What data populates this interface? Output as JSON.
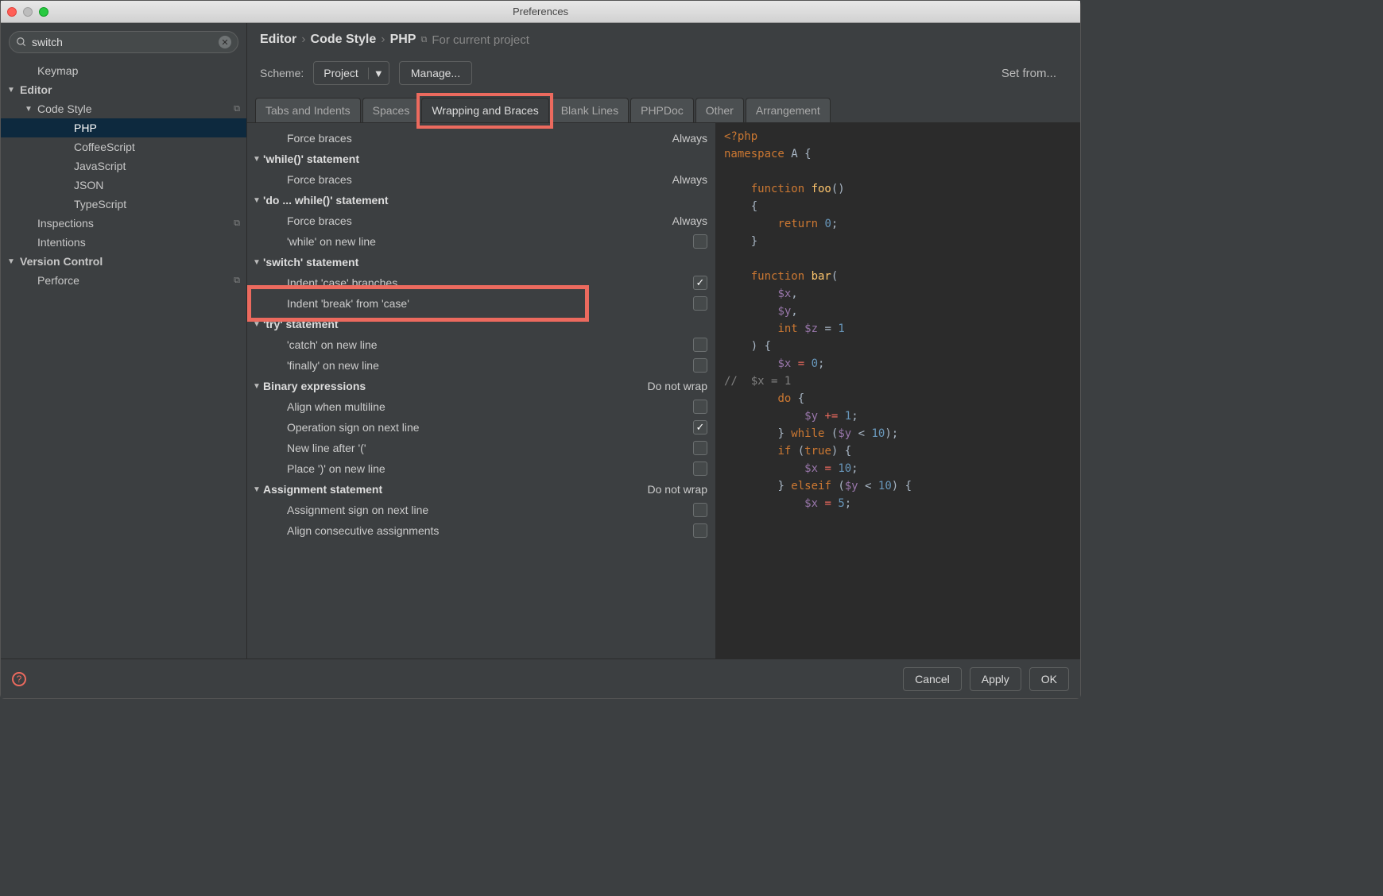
{
  "window": {
    "title": "Preferences"
  },
  "search": {
    "value": "switch"
  },
  "sidebar": {
    "items": [
      {
        "label": "Keymap",
        "level": 1,
        "arrow": ""
      },
      {
        "label": "Editor",
        "level": 0,
        "arrow": "▼",
        "bold": true
      },
      {
        "label": "Code Style",
        "level": 1,
        "arrow": "▼",
        "copy": true
      },
      {
        "label": "PHP",
        "level": 2,
        "selected": true
      },
      {
        "label": "CoffeeScript",
        "level": 2
      },
      {
        "label": "JavaScript",
        "level": 2
      },
      {
        "label": "JSON",
        "level": 2
      },
      {
        "label": "TypeScript",
        "level": 2
      },
      {
        "label": "Inspections",
        "level": 1,
        "copy": true
      },
      {
        "label": "Intentions",
        "level": 1
      },
      {
        "label": "Version Control",
        "level": 0,
        "arrow": "▼",
        "bold": true
      },
      {
        "label": "Perforce",
        "level": 1,
        "copy": true
      }
    ]
  },
  "breadcrumb": {
    "p1": "Editor",
    "p2": "Code Style",
    "p3": "PHP",
    "proj": "For current project"
  },
  "scheme": {
    "label": "Scheme:",
    "value": "Project",
    "manage": "Manage...",
    "setfrom": "Set from..."
  },
  "tabs": [
    "Tabs and Indents",
    "Spaces",
    "Wrapping and Braces",
    "Blank Lines",
    "PHPDoc",
    "Other",
    "Arrangement"
  ],
  "options": [
    {
      "type": "opt",
      "label": "Force braces",
      "value": "Always"
    },
    {
      "type": "group",
      "label": "'while()' statement"
    },
    {
      "type": "opt",
      "label": "Force braces",
      "value": "Always"
    },
    {
      "type": "group",
      "label": "'do ... while()' statement"
    },
    {
      "type": "opt",
      "label": "Force braces",
      "value": "Always"
    },
    {
      "type": "opt",
      "label": "'while' on new line",
      "cb": false
    },
    {
      "type": "group",
      "label": "'switch' statement"
    },
    {
      "type": "opt",
      "label": "Indent 'case' branches",
      "cb": true
    },
    {
      "type": "opt",
      "label": "Indent 'break' from 'case'",
      "cb": false,
      "highlight": true
    },
    {
      "type": "group",
      "label": "'try' statement"
    },
    {
      "type": "opt",
      "label": "'catch' on new line",
      "cb": false
    },
    {
      "type": "opt",
      "label": "'finally' on new line",
      "cb": false
    },
    {
      "type": "group",
      "label": "Binary expressions",
      "value": "Do not wrap"
    },
    {
      "type": "opt",
      "label": "Align when multiline",
      "cb": false
    },
    {
      "type": "opt",
      "label": "Operation sign on next line",
      "cb": true
    },
    {
      "type": "opt",
      "label": "New line after '('",
      "cb": false
    },
    {
      "type": "opt",
      "label": "Place ')' on new line",
      "cb": false
    },
    {
      "type": "group",
      "label": "Assignment statement",
      "value": "Do not wrap"
    },
    {
      "type": "opt",
      "label": "Assignment sign on next line",
      "cb": false
    },
    {
      "type": "opt",
      "label": "Align consecutive assignments",
      "cb": false
    }
  ],
  "footer": {
    "cancel": "Cancel",
    "apply": "Apply",
    "ok": "OK"
  },
  "code": {
    "l1a": "<?",
    "l1b": "php",
    "l2a": "namespace ",
    "l2b": "A {",
    "l3a": "function ",
    "l3b": "foo",
    "l3c": "()",
    "l4": "{",
    "l5a": "return ",
    "l5b": "0",
    "l5c": ";",
    "l6": "}",
    "l7a": "function ",
    "l7b": "bar",
    "l7c": "(",
    "l8a": "$x",
    "l8b": ",",
    "l9a": "$y",
    "l9b": ",",
    "l10a": "int ",
    "l10b": "$z ",
    "l10c": "= ",
    "l10d": "1",
    "l11": ") {",
    "l12a": "$x ",
    "l12b": "= ",
    "l12c": "0",
    "l12d": ";",
    "l13a": "//  ",
    "l13b": "$x = 1",
    "l14a": "do ",
    "l14b": "{",
    "l15a": "$y ",
    "l15b": "+= ",
    "l15c": "1",
    "l15d": ";",
    "l16a": "} ",
    "l16b": "while ",
    "l16c": "(",
    "l16d": "$y ",
    "l16e": "< ",
    "l16f": "10",
    "l16g": ");",
    "l17a": "if ",
    "l17b": "(",
    "l17c": "true",
    "l17d": ") {",
    "l18a": "$x ",
    "l18b": "= ",
    "l18c": "10",
    "l18d": ";",
    "l19a": "} ",
    "l19b": "elseif ",
    "l19c": "(",
    "l19d": "$y ",
    "l19e": "< ",
    "l19f": "10",
    "l19g": ") {",
    "l20a": "$x ",
    "l20b": "= ",
    "l20c": "5",
    "l20d": ";"
  }
}
